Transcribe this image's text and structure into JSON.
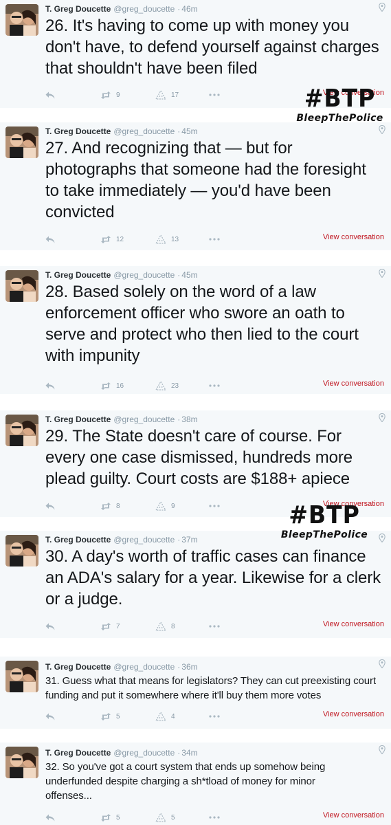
{
  "author": {
    "name": "T. Greg Doucette",
    "handle": "@greg_doucette"
  },
  "view_conversation_label": "View conversation",
  "tweets": [
    {
      "time": "46m",
      "text": "26. It's having to come up with money you don't have, to defend yourself against charges that shouldn't have been filed",
      "retweets": "9",
      "favorites": "17"
    },
    {
      "time": "45m",
      "text": "27. And recognizing that — but for photographs that someone had the foresight to take immediately — you'd have been convicted",
      "retweets": "12",
      "favorites": "13"
    },
    {
      "time": "45m",
      "text": "28. Based solely on the word of a law enforcement officer who swore an oath to serve and protect who then lied to the court with impunity",
      "retweets": "16",
      "favorites": "23"
    },
    {
      "time": "38m",
      "text": "29. The State doesn't care of course. For every one case dismissed, hundreds more plead guilty. Court costs are $188+ apiece",
      "retweets": "8",
      "favorites": "9"
    },
    {
      "time": "37m",
      "text": "30. A day's worth of traffic cases can finance an ADA's salary for a year. Likewise for a clerk or a judge.",
      "retweets": "7",
      "favorites": "8"
    },
    {
      "time": "36m",
      "text": "31. Guess what that means for legislators? They can cut preexisting court funding and put it somewhere where it'll buy them more votes",
      "retweets": "5",
      "favorites": "4"
    },
    {
      "time": "34m",
      "text": "32. So you've got a court system that ends up somehow being underfunded despite charging a sh*tload of money for minor offenses...",
      "retweets": "5",
      "favorites": "5"
    }
  ],
  "watermark": {
    "tag": "#BTP",
    "subtitle": "BleepThePolice"
  },
  "colors": {
    "card_bg": "#f5f8fa",
    "link_red": "#c0141e",
    "muted": "#8899a6"
  }
}
